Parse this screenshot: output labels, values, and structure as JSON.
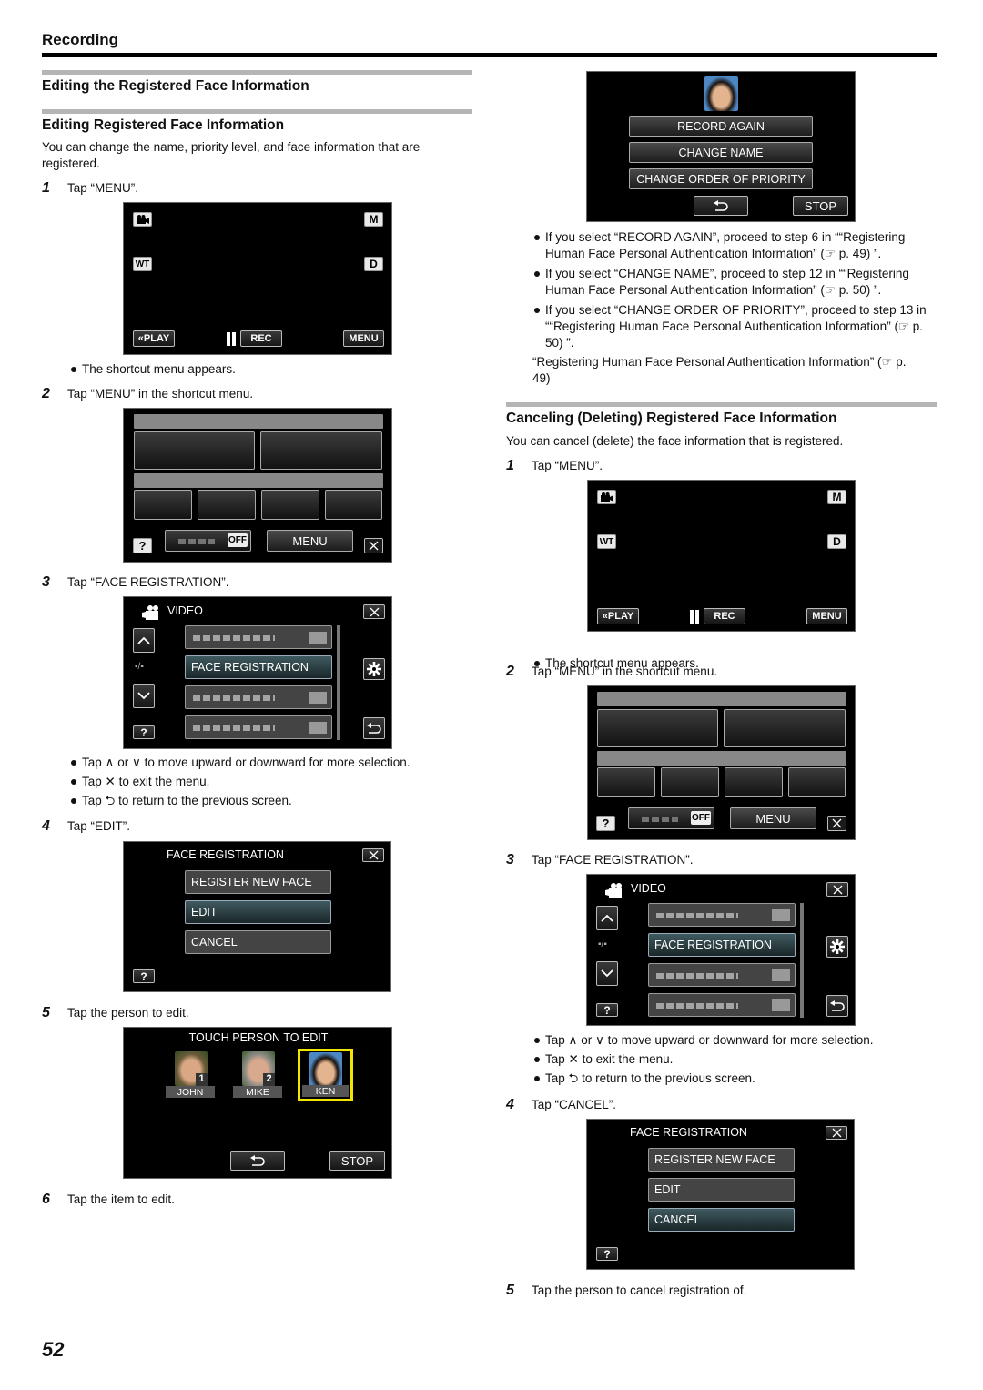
{
  "page": {
    "section_title": "Recording",
    "page_number": "52"
  },
  "left": {
    "h2a": "Editing the Registered Face Information",
    "h2b": "Editing Registered Face Information",
    "intro": "You can change the name, priority level, and face information that are registered.",
    "steps": [
      {
        "num": "1",
        "text": "Tap “MENU”."
      },
      {
        "num": "2",
        "text": "Tap “MENU” in the shortcut menu."
      },
      {
        "num": "3",
        "text": "Tap “FACE REGISTRATION”."
      },
      {
        "num": "4",
        "text": "Tap “EDIT”."
      },
      {
        "num": "5",
        "text": "Tap the person to edit."
      },
      {
        "num": "6",
        "text": "Tap the item to edit."
      }
    ],
    "note_shortcut": "The shortcut menu appears.",
    "notes_menu": [
      {
        "pre": "Tap",
        "icon1": "∧",
        "mid": "or",
        "icon2": "∨",
        "post": "to move upward or downward for more selection."
      },
      {
        "pre": "Tap",
        "icon1": "✕",
        "post": "to exit the menu."
      },
      {
        "pre": "Tap",
        "icon1": "⮌",
        "post": "to return to the previous screen."
      }
    ]
  },
  "right": {
    "bullets": [
      "If you select “RECORD AGAIN”, proceed to step 6 in ““Registering Human Face Personal Authentication Information” (☞ p. 49) ”.",
      "If you select “CHANGE NAME”, proceed to step 12 in ““Registering Human Face Personal Authentication Information” (☞ p. 50) ”.",
      "If you select “CHANGE ORDER OF PRIORITY”, proceed to step 13 in ““Registering Human Face Personal Authentication Information” (☞ p. 50) ”."
    ],
    "ref": "“Registering Human Face Personal Authentication Information” (☞ p. 49)",
    "h2": "Canceling (Deleting) Registered Face Information",
    "intro": "You can cancel (delete) the face information that is registered.",
    "steps": [
      {
        "num": "1",
        "text": "Tap “MENU”."
      },
      {
        "num": "2",
        "text": "Tap “MENU” in the shortcut menu."
      },
      {
        "num": "3",
        "text": "Tap “FACE REGISTRATION”."
      },
      {
        "num": "4",
        "text": "Tap “CANCEL”."
      },
      {
        "num": "5",
        "text": "Tap the person to cancel registration of."
      }
    ],
    "note_shortcut": "The shortcut menu appears."
  },
  "screens": {
    "rec": {
      "m": "M",
      "wt": "WT",
      "d": "D",
      "play": "«PLAY",
      "rec": "REC",
      "menu": "MENU"
    },
    "shortcut": {
      "off": "OFF",
      "menu": "MENU",
      "help": "?"
    },
    "video_menu": {
      "title": "VIDEO",
      "selected_item": "FACE REGISTRATION",
      "page": "▪/▪",
      "help": "?"
    },
    "face_reg": {
      "title": "FACE REGISTRATION",
      "items": [
        "REGISTER NEW FACE",
        "EDIT",
        "CANCEL"
      ],
      "help": "?"
    },
    "touch_person": {
      "title": "TOUCH PERSON TO EDIT",
      "persons": [
        {
          "name": "JOHN",
          "priority": "1"
        },
        {
          "name": "MIKE",
          "priority": "2"
        },
        {
          "name": "KEN",
          "priority": ""
        }
      ],
      "selected": "KEN",
      "stop": "STOP",
      "highlight_color": "#f2e600"
    },
    "edit_items": {
      "items": [
        "RECORD AGAIN",
        "CHANGE NAME",
        "CHANGE ORDER OF PRIORITY"
      ],
      "stop": "STOP"
    }
  }
}
